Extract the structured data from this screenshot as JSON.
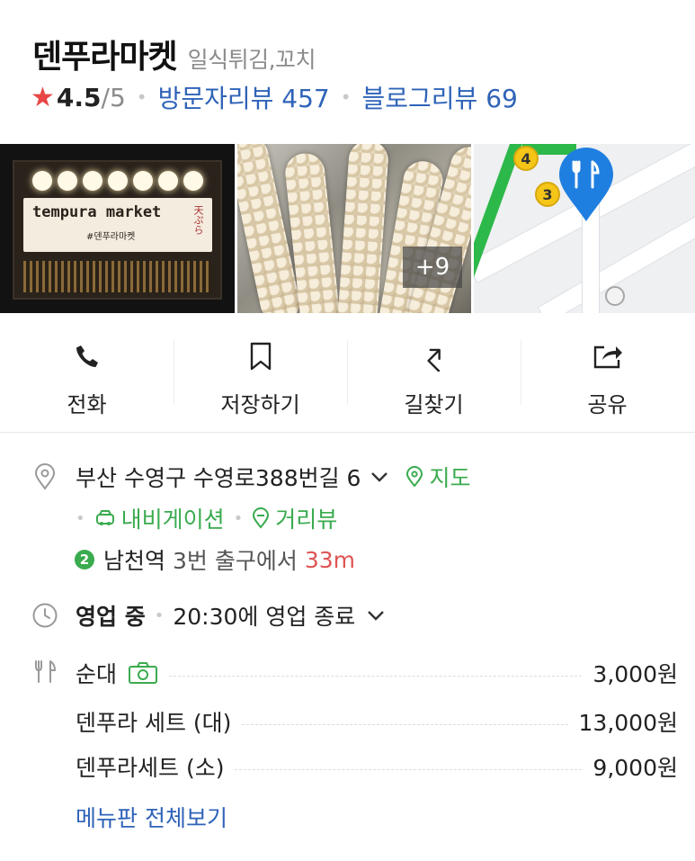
{
  "place": {
    "name": "덴푸라마켓",
    "category": "일식튀김,꼬치",
    "rating": "4.5",
    "rating_max": "/5",
    "visitor_reviews": "방문자리뷰 457",
    "blog_reviews": "블로그리뷰 69"
  },
  "photos": {
    "sign_text": "tempura market",
    "sign_sub": "#덴푸라마켓",
    "sign_mark": "天ぷら",
    "more_count": "+9",
    "map_exits": [
      "4",
      "3"
    ]
  },
  "actions": [
    {
      "label": "전화",
      "icon": "phone-icon"
    },
    {
      "label": "저장하기",
      "icon": "bookmark-icon"
    },
    {
      "label": "길찾기",
      "icon": "directions-icon"
    },
    {
      "label": "공유",
      "icon": "share-icon"
    }
  ],
  "address": {
    "text": "부산 수영구 수영로388번길 6",
    "map_link": "지도",
    "navigation_link": "내비게이션",
    "streetview_link": "거리뷰",
    "subway_line": "2",
    "subway_station": "남천역",
    "subway_exit": "3번 출구에서",
    "subway_distance": "33m"
  },
  "hours": {
    "status": "영업 중",
    "detail": "20:30에 영업 종료"
  },
  "menu": {
    "items": [
      {
        "name": "순대",
        "price": "3,000원",
        "has_photo": true
      },
      {
        "name": "덴푸라 세트 (대)",
        "price": "13,000원"
      },
      {
        "name": "덴푸라세트 (소)",
        "price": "9,000원"
      }
    ],
    "view_all": "메뉴판 전체보기"
  },
  "colors": {
    "accent_green": "#3aab4f",
    "link_blue": "#2f63b8",
    "star_red": "#e84545",
    "distance_red": "#e05454",
    "map_pin_blue": "#1f7fe0"
  }
}
